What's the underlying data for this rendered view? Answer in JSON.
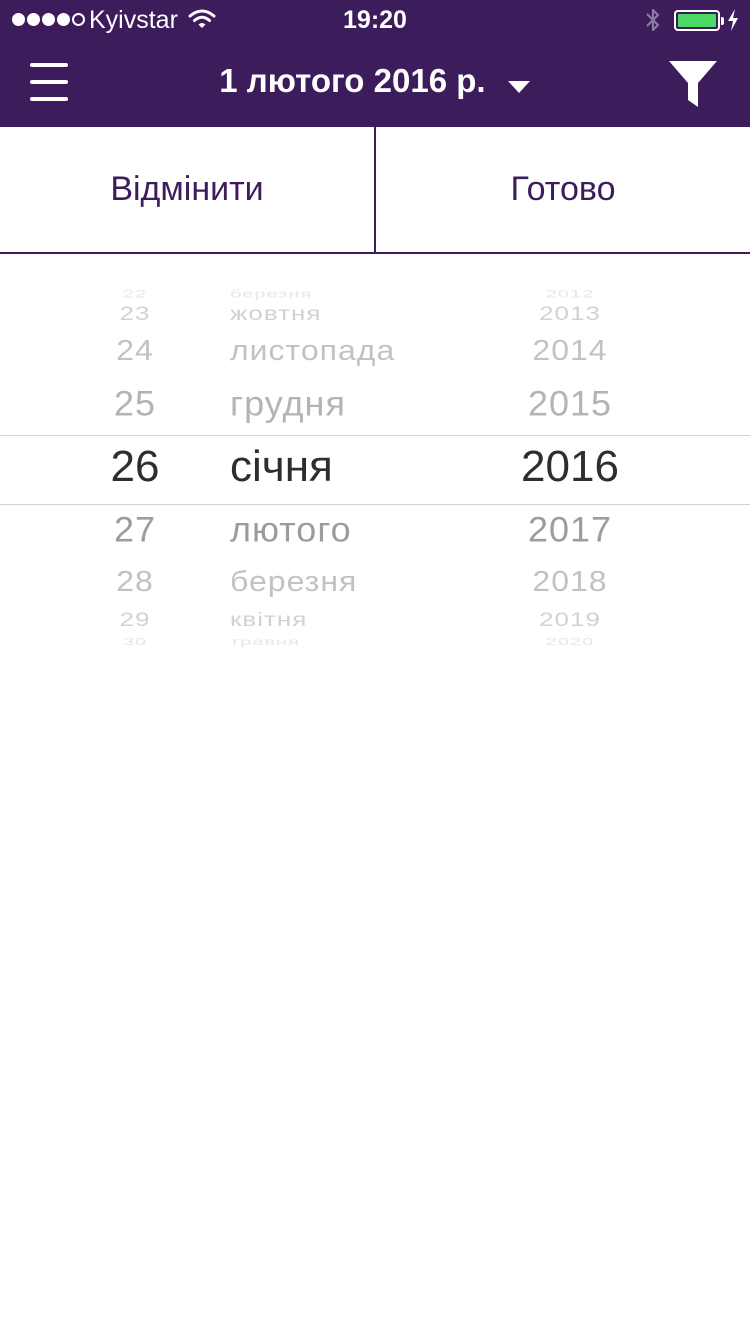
{
  "status_bar": {
    "carrier": "Kyivstar",
    "time": "19:20",
    "battery_level": 1.0
  },
  "header": {
    "title": "1 лютого 2016 р.",
    "menu_icon": "menu-icon",
    "dropdown_icon": "chevron-down-icon",
    "filter_icon": "filter-icon",
    "background": "#3d1c5b"
  },
  "actions": {
    "cancel_label": "Відмінити",
    "done_label": "Готово"
  },
  "picker": {
    "days": [
      "22",
      "23",
      "24",
      "25",
      "26",
      "27",
      "28",
      "29",
      "30"
    ],
    "months": [
      "березня",
      "жовтня",
      "листопада",
      "грудня",
      "січня",
      "лютого",
      "березня",
      "квітня",
      "травня"
    ],
    "years": [
      "2012",
      "2013",
      "2014",
      "2015",
      "2016",
      "2017",
      "2018",
      "2019",
      "2020"
    ],
    "selected": {
      "day": "26",
      "month": "січня",
      "year": "2016"
    }
  },
  "colors": {
    "accent": "#3d1c5b",
    "battery": "#4cd964"
  }
}
